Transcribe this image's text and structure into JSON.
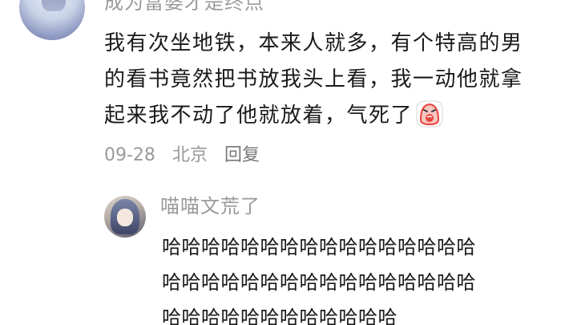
{
  "comment": {
    "username": "成为富婆才是终点",
    "lines": [
      "我有次坐地铁，本来人就多，有个特高的男",
      "的看书竟然把书放我头上看，我一动他就拿",
      "起来我不动了他就放着，气死了"
    ],
    "emoji_icon": "crying-angry-emoji-icon",
    "date": "09-28",
    "location": "北京",
    "reply_label": "回复"
  },
  "reply": {
    "username": "喵喵文荒了",
    "lines": [
      "哈哈哈哈哈哈哈哈哈哈哈哈哈哈哈哈",
      "哈哈哈哈哈哈哈哈哈哈哈哈哈哈哈哈",
      "哈哈哈哈哈哈哈哈哈哈哈哈"
    ]
  },
  "colors": {
    "text_primary": "#1a1a1a",
    "text_secondary": "#9a9a9a",
    "emoji_red": "#e8433c"
  }
}
